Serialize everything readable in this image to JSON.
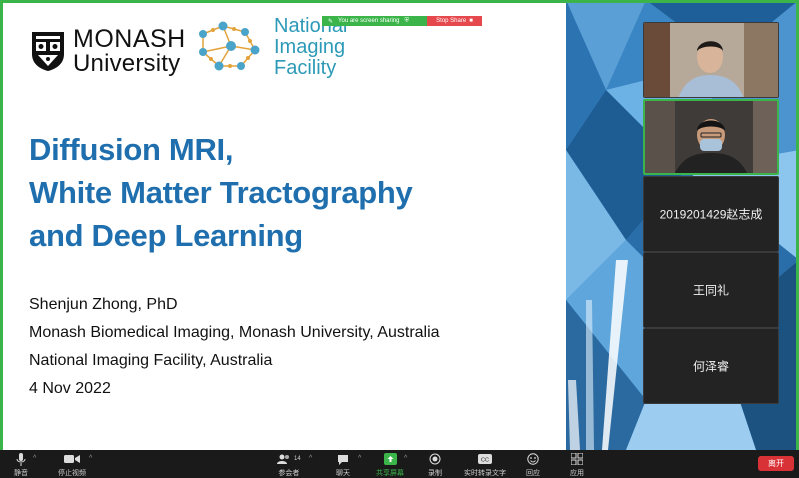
{
  "slide": {
    "logos": {
      "monash_line1": "MONASH",
      "monash_line2": "University",
      "nif_line1": "National",
      "nif_line2": "Imaging",
      "nif_line3": "Facility"
    },
    "title_lines": [
      "Diffusion MRI,",
      "White Matter Tractography",
      "and Deep Learning"
    ],
    "author": "Shenjun Zhong, PhD",
    "affiliation1": "Monash Biomedical Imaging, Monash University, Australia",
    "affiliation2": "National Imaging Facility, Australia",
    "date": "4 Nov 2022",
    "title_color": "#1f6fae"
  },
  "share_bar": {
    "status": "You are screen sharing",
    "stop_label": "Stop Share",
    "status_color": "#3bb54a",
    "stop_color": "#e5484d"
  },
  "participants": [
    {
      "name": "",
      "video": true,
      "active_speaker": false
    },
    {
      "name": "",
      "video": true,
      "active_speaker": true
    },
    {
      "name": "2019201429赵志成",
      "video": false
    },
    {
      "name": "王同礼",
      "video": false
    },
    {
      "name": "何泽睿",
      "video": false
    }
  ],
  "toolbar": {
    "mute": "静音",
    "stop_video": "停止视频",
    "participants": "参会者",
    "participant_count": "14",
    "chat": "聊天",
    "share_screen": "共享屏幕",
    "record": "录制",
    "live_transcript": "实时转录文字",
    "reactions": "回应",
    "apps": "应用",
    "leave": "离开",
    "leave_color": "#d93236",
    "share_color": "#3bb54a"
  }
}
